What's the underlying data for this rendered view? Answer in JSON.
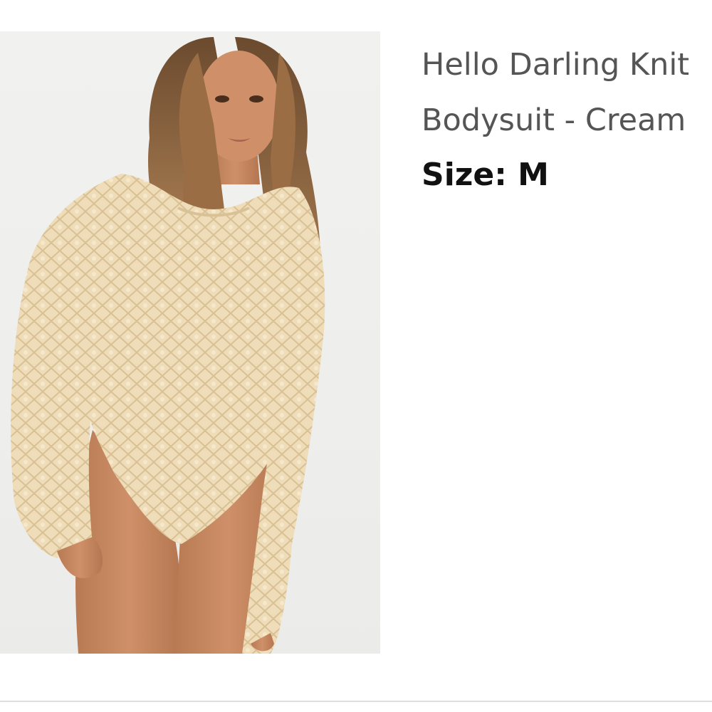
{
  "product": {
    "title_line_1": "Hello Darling Knit",
    "title_line_2": "Bodysuit - Cream",
    "size_label": "Size:",
    "size_value": "M"
  },
  "image": {
    "background_color": "#eeeeec",
    "garment_color": "#efdcb8"
  }
}
